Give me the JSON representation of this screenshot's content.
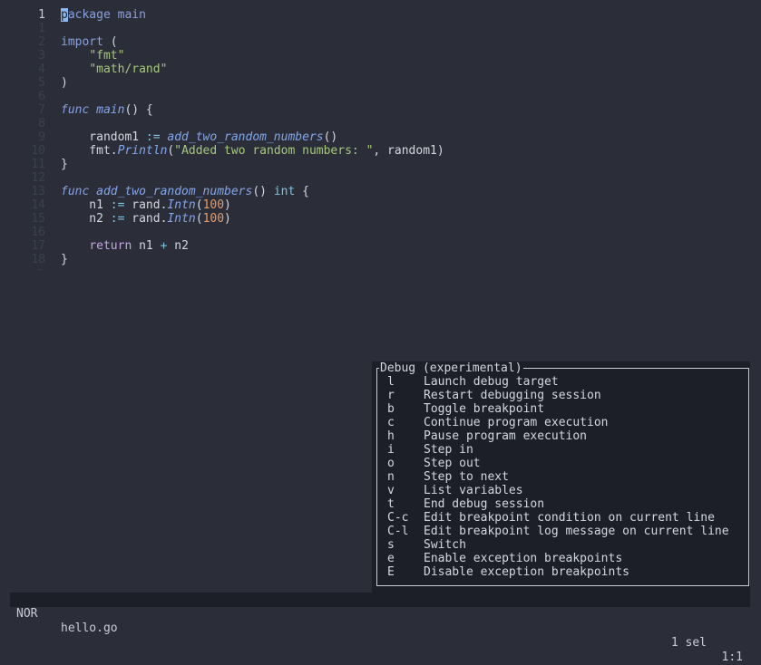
{
  "editor": {
    "lines": [
      {
        "num": "1",
        "current": true,
        "tokens": [
          {
            "t": "p",
            "c": "cursor"
          },
          {
            "t": "ackage",
            "c": "tok-kw"
          },
          {
            "t": " ",
            "c": "tok-plain"
          },
          {
            "t": "main",
            "c": "tok-kw"
          }
        ]
      },
      {
        "num": "1",
        "tokens": []
      },
      {
        "num": "2",
        "tokens": [
          {
            "t": "import",
            "c": "tok-kw"
          },
          {
            "t": " (",
            "c": "tok-punct"
          }
        ]
      },
      {
        "num": "3",
        "tokens": [
          {
            "t": "    ",
            "c": "tok-plain"
          },
          {
            "t": "\"fmt\"",
            "c": "tok-str"
          }
        ]
      },
      {
        "num": "4",
        "tokens": [
          {
            "t": "    ",
            "c": "tok-plain"
          },
          {
            "t": "\"math/rand\"",
            "c": "tok-str"
          }
        ]
      },
      {
        "num": "5",
        "tokens": [
          {
            "t": ")",
            "c": "tok-punct"
          }
        ]
      },
      {
        "num": "6",
        "tokens": []
      },
      {
        "num": "7",
        "tokens": [
          {
            "t": "func",
            "c": "tok-kw-i"
          },
          {
            "t": " ",
            "c": "tok-plain"
          },
          {
            "t": "main",
            "c": "tok-fn"
          },
          {
            "t": "() {",
            "c": "tok-punct"
          }
        ]
      },
      {
        "num": "8",
        "tokens": []
      },
      {
        "num": "9",
        "tokens": [
          {
            "t": "    random1 ",
            "c": "tok-plain"
          },
          {
            "t": ":=",
            "c": "tok-op"
          },
          {
            "t": " ",
            "c": "tok-plain"
          },
          {
            "t": "add_two_random_numbers",
            "c": "tok-fn"
          },
          {
            "t": "()",
            "c": "tok-punct"
          }
        ]
      },
      {
        "num": "10",
        "tokens": [
          {
            "t": "    fmt.",
            "c": "tok-plain"
          },
          {
            "t": "Println",
            "c": "tok-fn"
          },
          {
            "t": "(",
            "c": "tok-punct"
          },
          {
            "t": "\"Added two random numbers: \"",
            "c": "tok-str"
          },
          {
            "t": ", random1)",
            "c": "tok-plain"
          }
        ]
      },
      {
        "num": "11",
        "tokens": [
          {
            "t": "}",
            "c": "tok-punct"
          }
        ]
      },
      {
        "num": "12",
        "tokens": []
      },
      {
        "num": "13",
        "tokens": [
          {
            "t": "func",
            "c": "tok-kw-i"
          },
          {
            "t": " ",
            "c": "tok-plain"
          },
          {
            "t": "add_two_random_numbers",
            "c": "tok-fn"
          },
          {
            "t": "() ",
            "c": "tok-punct"
          },
          {
            "t": "int",
            "c": "tok-type"
          },
          {
            "t": " {",
            "c": "tok-punct"
          }
        ]
      },
      {
        "num": "14",
        "tokens": [
          {
            "t": "    n1 ",
            "c": "tok-plain"
          },
          {
            "t": ":=",
            "c": "tok-op"
          },
          {
            "t": " rand.",
            "c": "tok-plain"
          },
          {
            "t": "Intn",
            "c": "tok-fn"
          },
          {
            "t": "(",
            "c": "tok-punct"
          },
          {
            "t": "100",
            "c": "tok-num"
          },
          {
            "t": ")",
            "c": "tok-punct"
          }
        ]
      },
      {
        "num": "15",
        "tokens": [
          {
            "t": "    n2 ",
            "c": "tok-plain"
          },
          {
            "t": ":=",
            "c": "tok-op"
          },
          {
            "t": " rand.",
            "c": "tok-plain"
          },
          {
            "t": "Intn",
            "c": "tok-fn"
          },
          {
            "t": "(",
            "c": "tok-punct"
          },
          {
            "t": "100",
            "c": "tok-num"
          },
          {
            "t": ")",
            "c": "tok-punct"
          }
        ]
      },
      {
        "num": "16",
        "tokens": []
      },
      {
        "num": "17",
        "tokens": [
          {
            "t": "    ",
            "c": "tok-plain"
          },
          {
            "t": "return",
            "c": "tok-ctrl"
          },
          {
            "t": " n1 ",
            "c": "tok-plain"
          },
          {
            "t": "+",
            "c": "tok-op"
          },
          {
            "t": " n2",
            "c": "tok-plain"
          }
        ]
      },
      {
        "num": "18",
        "tokens": [
          {
            "t": "}",
            "c": "tok-punct"
          }
        ]
      }
    ],
    "end_marker": "~"
  },
  "popup": {
    "title": "Debug (experimental)",
    "items": [
      {
        "key": "l",
        "desc": "Launch debug target"
      },
      {
        "key": "r",
        "desc": "Restart debugging session"
      },
      {
        "key": "b",
        "desc": "Toggle breakpoint"
      },
      {
        "key": "c",
        "desc": "Continue program execution"
      },
      {
        "key": "h",
        "desc": "Pause program execution"
      },
      {
        "key": "i",
        "desc": "Step in"
      },
      {
        "key": "o",
        "desc": "Step out"
      },
      {
        "key": "n",
        "desc": "Step to next"
      },
      {
        "key": "v",
        "desc": "List variables"
      },
      {
        "key": "t",
        "desc": "End debug session"
      },
      {
        "key": "C-c",
        "desc": "Edit breakpoint condition on current line"
      },
      {
        "key": "C-l",
        "desc": "Edit breakpoint log message on current line"
      },
      {
        "key": "s",
        "desc": "Switch"
      },
      {
        "key": "e",
        "desc": "Enable exception breakpoints"
      },
      {
        "key": "E",
        "desc": "Disable exception breakpoints"
      }
    ]
  },
  "statusbar": {
    "mode": "NOR",
    "file": "hello.go",
    "selections": "1 sel",
    "position": "1:1"
  },
  "colors": {
    "background": "#2b2e38",
    "popup_background": "#1c1f27",
    "keyword": "#8aa0dc",
    "string": "#a6c97a",
    "number": "#e59e67",
    "function": "#82a6ec",
    "cursor": "#8cb8f0"
  }
}
